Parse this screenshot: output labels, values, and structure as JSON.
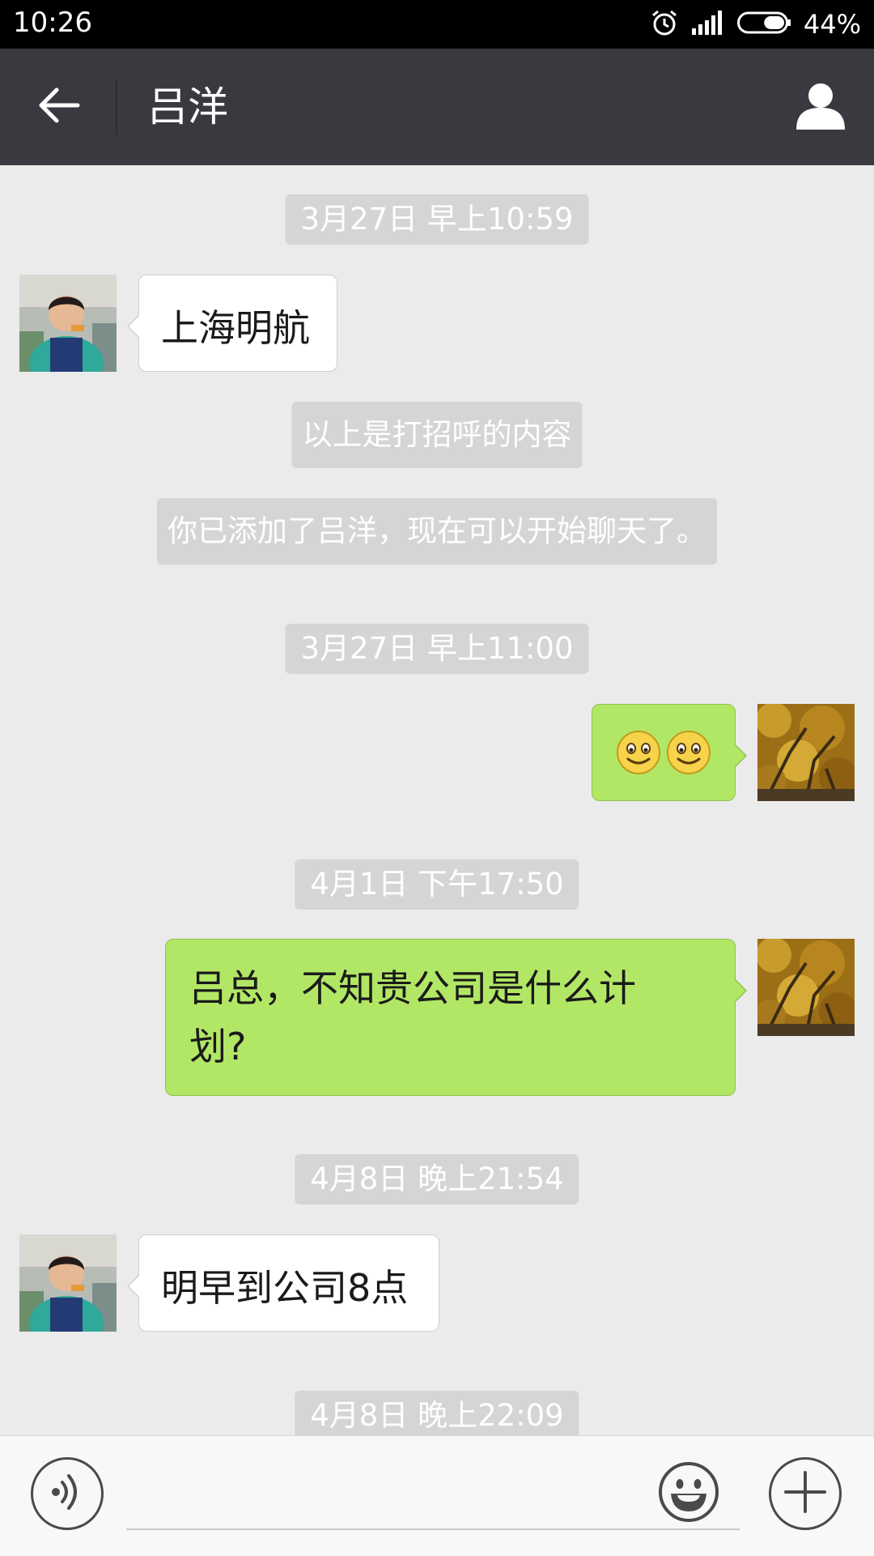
{
  "status_bar": {
    "time": "10:26",
    "battery_percent": "44%",
    "battery_level": 0.44,
    "icons": [
      "alarm-icon",
      "signal-icon",
      "battery-icon"
    ]
  },
  "header": {
    "title": "吕洋",
    "back_icon": "back-arrow-icon",
    "profile_icon": "person-icon",
    "background": "#393a3f"
  },
  "messages": {
    "ts1": "3月27日 早上10:59",
    "msg1": "上海明航",
    "note1": "以上是打招呼的内容",
    "note2": "你已添加了吕洋，现在可以开始聊天了。",
    "ts2": "3月27日 早上11:00",
    "msg2_emoji_count": 2,
    "ts3": "4月1日 下午17:50",
    "msg3_line1": "吕总，不知贵公司是什么计",
    "msg3_line2": "划?",
    "ts4": "4月8日 晚上21:54",
    "msg4": "明早到公司8点",
    "ts5": "4月8日 晚上22:09"
  },
  "input_bar": {
    "voice_icon": "voice-icon",
    "emoji_icon": "emoji-icon",
    "more_icon": "plus-icon",
    "text": ""
  },
  "colors": {
    "chat_background": "#ebebeb",
    "outgoing_bubble": "#b2e766",
    "incoming_bubble": "#ffffff",
    "system_note": "#d5d5d5"
  }
}
